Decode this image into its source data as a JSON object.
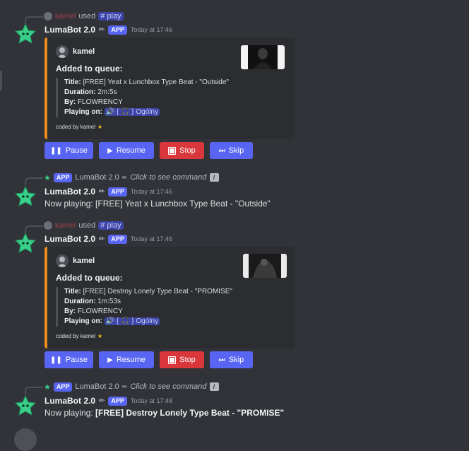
{
  "bot": {
    "name": "LumaBot 2.0",
    "badge": "APP"
  },
  "messages": [
    {
      "reply": {
        "user": "kamel",
        "used": "used",
        "command": "play"
      },
      "time": "Today at 17:46",
      "embed": {
        "author": "kamel",
        "title": "Added to queue:",
        "title_label": "Title:",
        "title_value": "[FREE] Yeat x Lunchbox Type Beat - \"Outside\"",
        "duration_label": "Duration:",
        "duration_value": "2m:5s",
        "by_label": "By:",
        "by_value": "FLOWRENCY",
        "playing_label": "Playing on:",
        "channel": "{ 🎧 } Ogólny",
        "footer": "coded by kamel"
      },
      "buttons": {
        "pause": "Pause",
        "resume": "Resume",
        "stop": "Stop",
        "skip": "Skip"
      }
    },
    {
      "reply": {
        "badge": "APP",
        "user": "LumaBot 2.0",
        "hint": "Click to see command"
      },
      "time": "Today at 17:46",
      "content": "Now playing: [FREE] Yeat x Lunchbox Type Beat - \"Outside\""
    },
    {
      "reply": {
        "user": "kamel",
        "used": "used",
        "command": "play"
      },
      "time": "Today at 17:46",
      "embed": {
        "author": "kamel",
        "title": "Added to queue:",
        "title_label": "Title:",
        "title_value": "[FREE] Destroy Lonely Type Beat - \"PROMISE\"",
        "duration_label": "Duration:",
        "duration_value": "1m:53s",
        "by_label": "By:",
        "by_value": "FLOWRENCY",
        "playing_label": "Playing on:",
        "channel": "{ 🎧 } Ogólny",
        "footer": "coded by kamel"
      },
      "buttons": {
        "pause": "Pause",
        "resume": "Resume",
        "stop": "Stop",
        "skip": "Skip"
      }
    },
    {
      "reply": {
        "badge": "APP",
        "user": "LumaBot 2.0",
        "hint": "Click to see command"
      },
      "time": "Today at 17:48",
      "content_prefix": "Now playing:",
      "content_bold": "[FREE] Destroy Lonely Type Beat - \"PROMISE\""
    }
  ],
  "icons": {
    "bot_avatar": "green-star-icon",
    "bot_emoji": "pencil-icon",
    "footer_emoji": "star-icon",
    "speaker": "speaker-icon",
    "hash": "hash-icon",
    "slash": "slash-command-icon"
  },
  "colors": {
    "background": "#313338",
    "embed_bg": "#2b2d31",
    "embed_accent": "#f08c1c",
    "primary_button": "#5865f2",
    "danger_button": "#da373c",
    "app_badge": "#5865f2"
  }
}
